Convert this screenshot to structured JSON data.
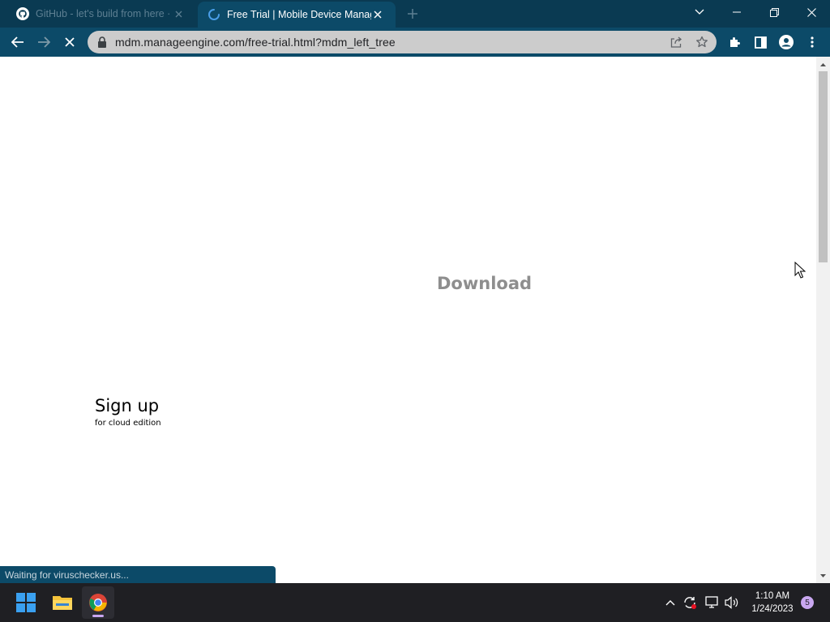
{
  "browser": {
    "tabs": [
      {
        "title": "GitHub - let's build from here · GitHub",
        "active": false,
        "icon": "github-icon"
      },
      {
        "title": "Free Trial | Mobile Device Management",
        "active": true,
        "icon": "loading-spinner-icon"
      }
    ],
    "url": "mdm.manageengine.com/free-trial.html?mdm_left_tree",
    "status_text": "Waiting for viruschecker.us..."
  },
  "page": {
    "download_label": "Download",
    "signup_title": "Sign up",
    "signup_subtitle": "for cloud edition"
  },
  "taskbar": {
    "apps": [
      "windows-start-icon",
      "file-explorer-icon",
      "chrome-icon"
    ],
    "time": "1:10 AM",
    "date": "1/24/2023",
    "notification_badge": "5"
  },
  "colors": {
    "tabstrip": "#0a3a52",
    "toolbar": "#0c4a68",
    "omnibox": "#cccccc",
    "taskbar": "#1f1f23"
  }
}
